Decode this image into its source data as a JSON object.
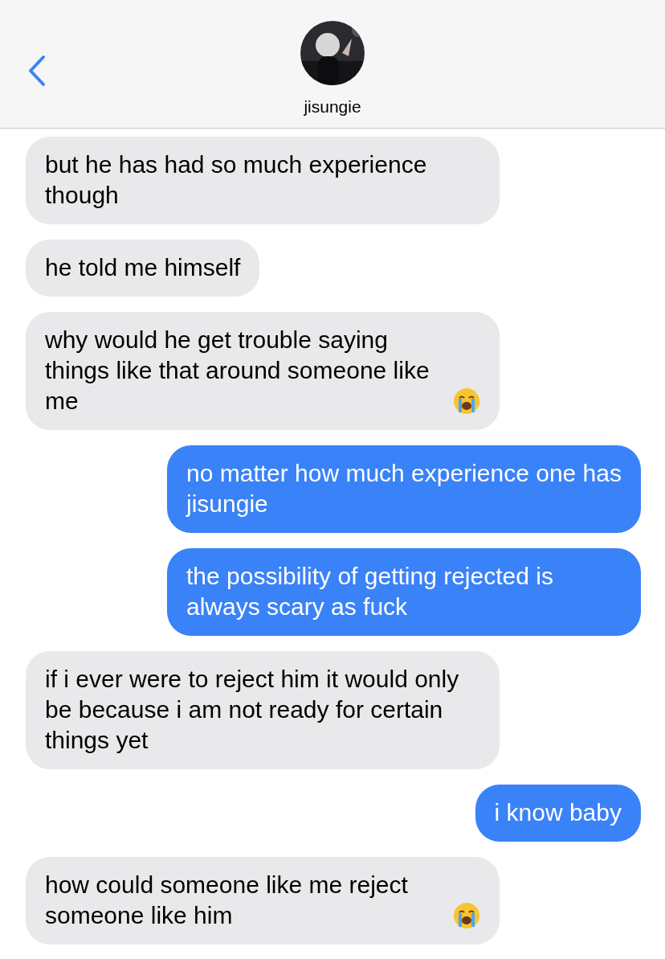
{
  "header": {
    "contact_name": "jisungie"
  },
  "messages": [
    {
      "kind": "received",
      "text": "but he has had so much experience though",
      "has_emoji": false
    },
    {
      "kind": "received",
      "text": "he told me himself",
      "has_emoji": false
    },
    {
      "kind": "received",
      "text": "why would he get trouble saying things like that around someone like me",
      "has_emoji": true
    },
    {
      "kind": "sent",
      "text": "no matter how much experience one has jisungie",
      "has_emoji": false
    },
    {
      "kind": "sent",
      "text": "the possibility of getting rejected is always scary as fuck",
      "has_emoji": false
    },
    {
      "kind": "received",
      "text": "if i ever were to reject him it would only be because i am not ready for certain things yet",
      "has_emoji": false
    },
    {
      "kind": "sent",
      "text": "i know baby",
      "has_emoji": false
    },
    {
      "kind": "received",
      "text": "how could someone like me reject someone like him",
      "has_emoji": true
    }
  ]
}
